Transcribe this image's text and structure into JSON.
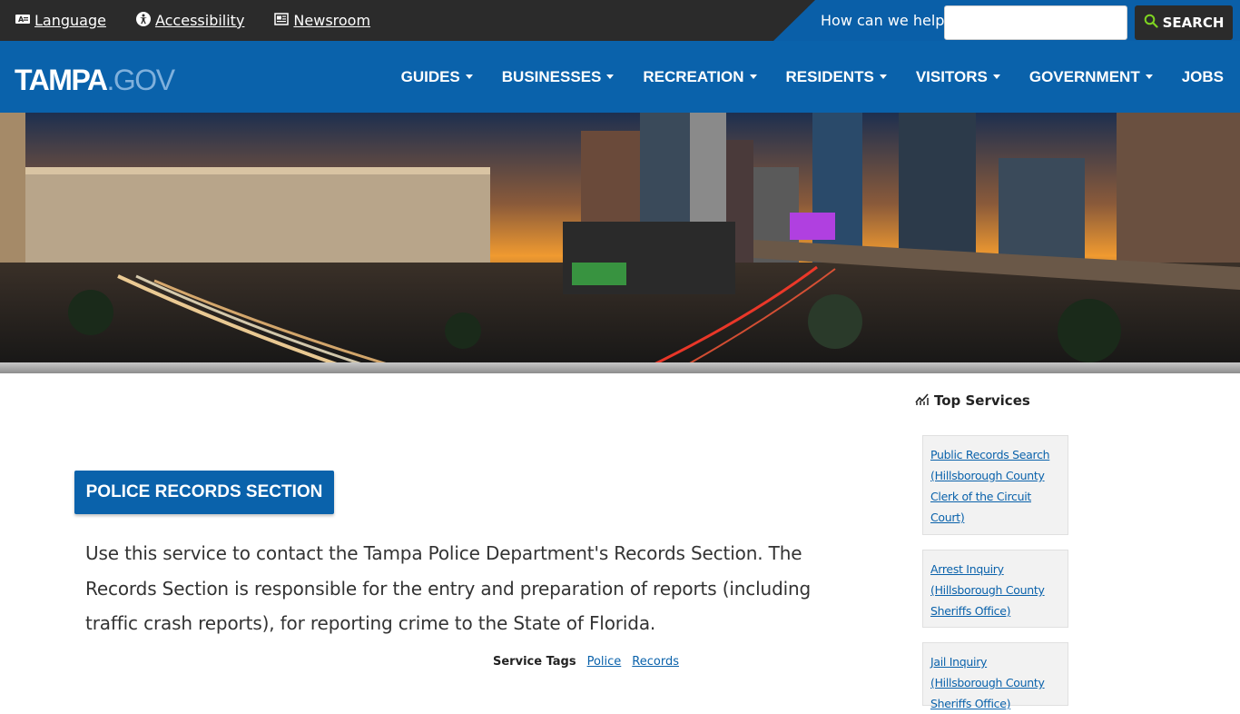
{
  "utility": {
    "language": "Language",
    "accessibility": "Accessibility",
    "newsroom": "Newsroom",
    "search_label": "How can we help?",
    "search_placeholder": "",
    "search_button": "SEARCH"
  },
  "logo": {
    "primary": "TAMPA",
    "secondary": ".GOV"
  },
  "nav": {
    "items": [
      {
        "label": "GUIDES",
        "dropdown": true
      },
      {
        "label": "BUSINESSES",
        "dropdown": true
      },
      {
        "label": "RECREATION",
        "dropdown": true
      },
      {
        "label": "RESIDENTS",
        "dropdown": true
      },
      {
        "label": "VISITORS",
        "dropdown": true
      },
      {
        "label": "GOVERNMENT",
        "dropdown": true
      },
      {
        "label": "JOBS",
        "dropdown": false
      }
    ]
  },
  "page": {
    "title": "POLICE RECORDS SECTION",
    "description": "Use this service to contact the Tampa Police Department's Records Section. The Records Section is responsible for the entry and preparation of reports (including traffic crash reports), for reporting crime to the State of Florida.",
    "tags_label": "Service Tags",
    "tags": [
      "Police",
      "Records"
    ]
  },
  "sidebar": {
    "title": "Top Services",
    "services": [
      "Public Records Search (Hillsborough County Clerk of the Circuit Court)",
      "Arrest Inquiry (Hillsborough County Sheriffs Office)",
      "Jail Inquiry (Hillsborough County Sheriffs Office)"
    ]
  },
  "colors": {
    "brand_blue": "#0a62ab",
    "dark_bar": "#2b2b2b",
    "search_accent": "#7ed321"
  },
  "icons": [
    "language-icon",
    "accessibility-icon",
    "newsroom-icon",
    "search-icon",
    "chart-icon"
  ]
}
